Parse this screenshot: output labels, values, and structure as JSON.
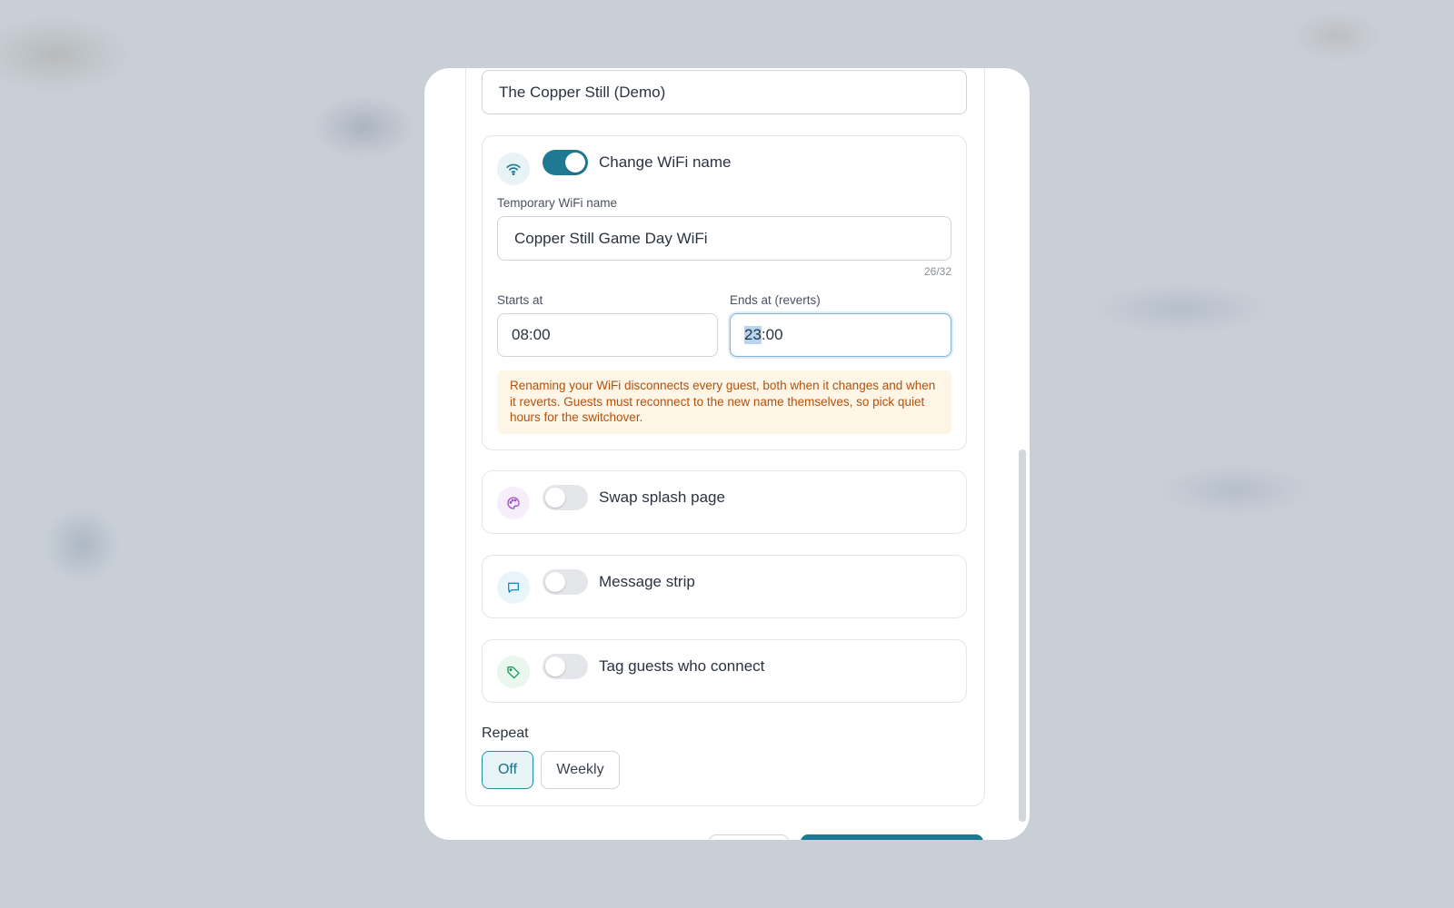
{
  "venue_name_field": {
    "value": "The Copper Still (Demo)"
  },
  "wifi_card": {
    "toggle_label": "Change WiFi name",
    "toggle_on": true,
    "temp_name_label": "Temporary WiFi name",
    "temp_name_value": "Copper Still Game Day WiFi",
    "char_counter": "26/32",
    "starts_label": "Starts at",
    "starts_value": "08:00",
    "ends_label": "Ends at (reverts)",
    "ends_value_selected": "23",
    "ends_value_rest": ":00",
    "warning": "Renaming your WiFi disconnects every guest, both when it changes and when it reverts. Guests must reconnect to the new name themselves, so pick quiet hours for the switchover."
  },
  "options": [
    {
      "label": "Swap splash page",
      "icon": "palette-icon",
      "enabled": false,
      "color": "#a24fc9"
    },
    {
      "label": "Message strip",
      "icon": "chat-bubble-icon",
      "enabled": false,
      "color": "#1a8fc0"
    },
    {
      "label": "Tag guests who connect",
      "icon": "tag-icon",
      "enabled": false,
      "color": "#1e9a5a"
    }
  ],
  "repeat": {
    "label": "Repeat",
    "options": [
      "Off",
      "Weekly"
    ],
    "selected": "Off"
  },
  "colors": {
    "accent": "#1e7a93",
    "warning_text": "#b5500c",
    "warning_bg": "#fdf6e7"
  }
}
